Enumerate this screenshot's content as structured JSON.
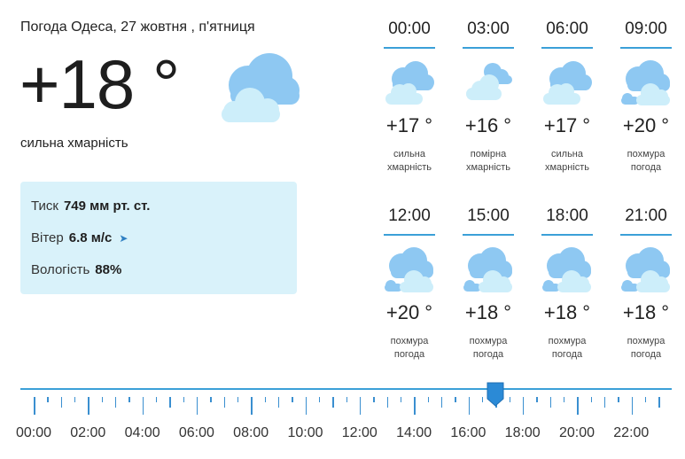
{
  "header": {
    "title": "Погода Одеса, 27 жовтня , п'ятниця",
    "current_temp": "+18 °",
    "current_condition": "сильна хмарність",
    "current_icon": "cloud-icon"
  },
  "details": {
    "pressure_label": "Тиск",
    "pressure_value": "749 мм рт. ст.",
    "wind_label": "Вітер",
    "wind_value": "6.8 м/с",
    "wind_icon": "wind-direction-arrow-icon",
    "humidity_label": "Вологість",
    "humidity_value": "88%"
  },
  "forecast": [
    {
      "time": "00:00",
      "temp": "+17 °",
      "desc1": "сильна",
      "desc2": "хмарність",
      "icon": "cloud-icon"
    },
    {
      "time": "03:00",
      "temp": "+16 °",
      "desc1": "помірна",
      "desc2": "хмарність",
      "icon": "cloud-icon"
    },
    {
      "time": "06:00",
      "temp": "+17 °",
      "desc1": "сильна",
      "desc2": "хмарність",
      "icon": "cloud-icon"
    },
    {
      "time": "09:00",
      "temp": "+20 °",
      "desc1": "похмура",
      "desc2": "погода",
      "icon": "overcast-icon"
    },
    {
      "time": "12:00",
      "temp": "+20 °",
      "desc1": "похмура",
      "desc2": "погода",
      "icon": "overcast-icon"
    },
    {
      "time": "15:00",
      "temp": "+18 °",
      "desc1": "похмура",
      "desc2": "погода",
      "icon": "overcast-icon"
    },
    {
      "time": "18:00",
      "temp": "+18 °",
      "desc1": "похмура",
      "desc2": "погода",
      "icon": "overcast-icon"
    },
    {
      "time": "21:00",
      "temp": "+18 °",
      "desc1": "похмура",
      "desc2": "погода",
      "icon": "overcast-icon"
    }
  ],
  "timeline": {
    "labels": [
      "00:00",
      "02:00",
      "04:00",
      "06:00",
      "08:00",
      "10:00",
      "12:00",
      "14:00",
      "16:00",
      "18:00",
      "20:00",
      "22:00"
    ],
    "selected_hour": 17
  },
  "colors": {
    "accent": "#3ba0d8",
    "info_bg": "#d9f2fa",
    "cloud_dark": "#8ec8f2",
    "cloud_light": "#cdeefa"
  }
}
